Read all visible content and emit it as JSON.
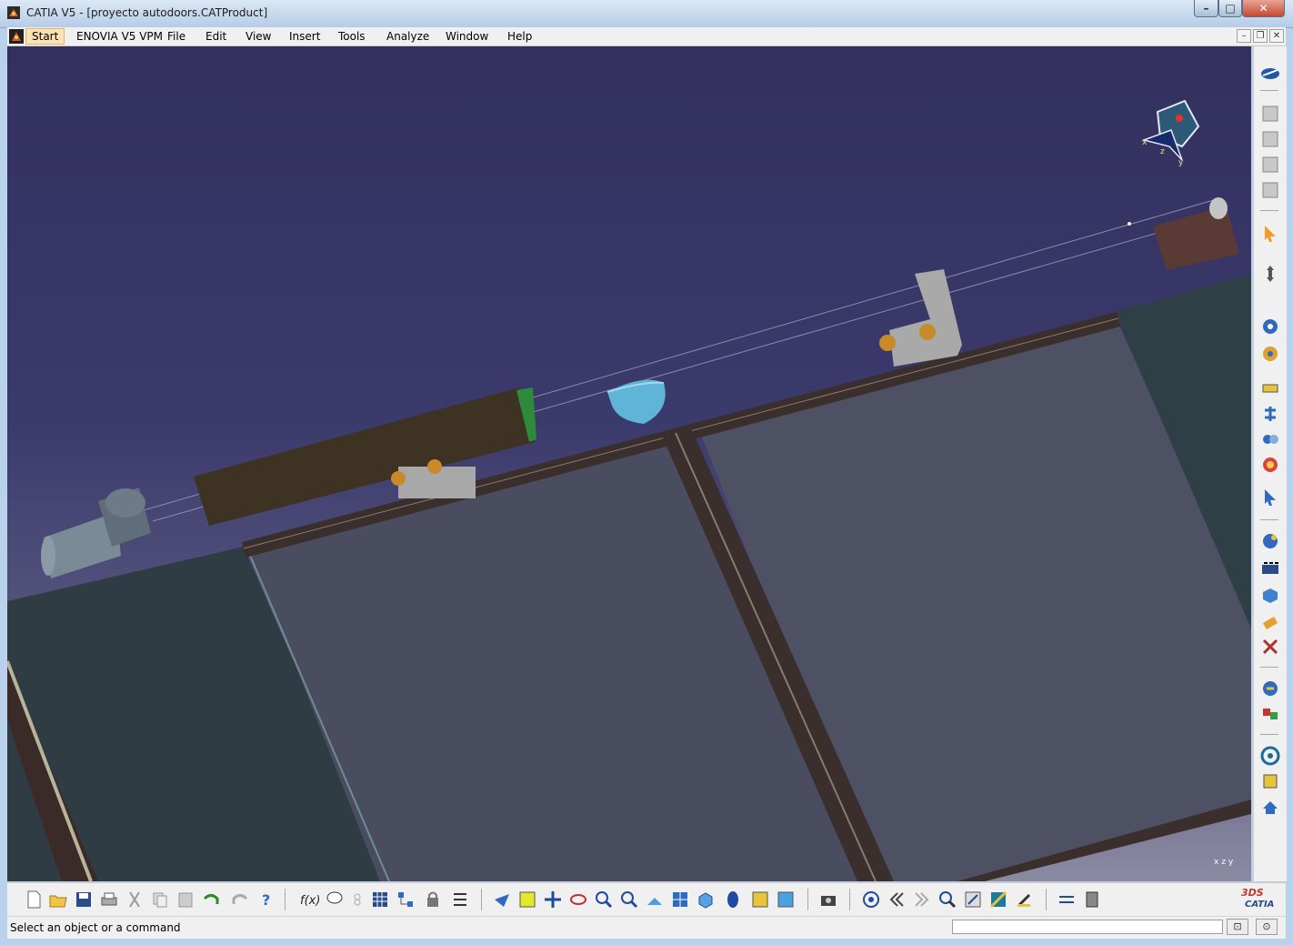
{
  "window": {
    "title": "CATIA V5 - [proyecto autodoors.CATProduct]",
    "minimize_glyph": "–",
    "maximize_glyph": "□",
    "close_glyph": "✕"
  },
  "menubar": {
    "items": [
      {
        "label": "Start"
      },
      {
        "label": "ENOVIA V5 VPM"
      },
      {
        "label": "File"
      },
      {
        "label": "Edit"
      },
      {
        "label": "View"
      },
      {
        "label": "Insert"
      },
      {
        "label": "Tools"
      },
      {
        "label": "Analyze"
      },
      {
        "label": "Window"
      },
      {
        "label": "Help"
      }
    ],
    "doc_min": "–",
    "doc_restore": "❐",
    "doc_close": "✕"
  },
  "viewport": {
    "axis_label": "x z y",
    "triad_labels": {
      "x": "x",
      "y": "y",
      "z": "z"
    },
    "background_top": "#33305e",
    "background_bottom": "#8a8aa2"
  },
  "toolbars": {
    "standard": [
      "new-icon",
      "open-icon",
      "save-icon",
      "print-icon",
      "cut-icon",
      "copy-icon",
      "paste-icon",
      "undo-icon",
      "redo-icon",
      "whats-this-icon"
    ],
    "knowledge": [
      "formula-icon",
      "comment-icon",
      "link-icon"
    ],
    "catalog": [
      "catalog-browser-icon",
      "product-structure-icon",
      "lock-icon",
      "list-icon"
    ],
    "view": [
      "fly-mode-icon",
      "fit-all-icon",
      "pan-icon",
      "rotate-icon",
      "zoom-in-icon",
      "zoom-out-icon",
      "normal-view-icon",
      "multi-view-icon",
      "iso-view-icon",
      "render-style-icon",
      "hide-show-icon",
      "swap-visible-icon"
    ],
    "capture": [
      "camera-icon"
    ],
    "misc": [
      "target-icon",
      "previous-icon",
      "next-icon",
      "search-icon",
      "measure-icon",
      "apply-material-icon",
      "paint-icon",
      "compare-icon",
      "publication-icon"
    ],
    "right": [
      "manipulate-icon",
      "cut-section-icon",
      "spec-tree-1-icon",
      "spec-tree-2-icon",
      "spec-tree-3-icon",
      "spec-tree-4-icon",
      "select-icon",
      "move-icon",
      "snap-icon",
      "explode-icon",
      "constraint-1-icon",
      "constraint-2-icon",
      "constraint-3-icon",
      "constraint-4-icon",
      "update-icon",
      "component-1-icon",
      "component-2-icon",
      "component-3-icon",
      "component-4-icon",
      "component-5-icon",
      "space-analysis-1-icon",
      "space-analysis-2-icon",
      "publish-1-icon",
      "publish-2-icon",
      "publish-3-icon"
    ]
  },
  "brand": {
    "logo_text": "CATIA",
    "logo_prefix": "3DS"
  },
  "status": {
    "message": "Select an object or a command",
    "command_value": "",
    "btn1": "⊡",
    "btn2": "⊙"
  },
  "colors": {
    "accent": "#e3b56a",
    "frame": "#b9d1ea",
    "rail": "#3a2f2c"
  }
}
